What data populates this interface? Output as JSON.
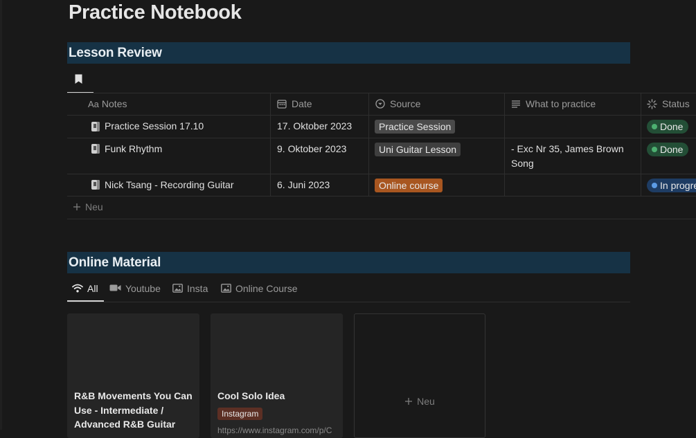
{
  "page": {
    "title": "Practice Notebook"
  },
  "lesson_review": {
    "header": "Lesson Review",
    "view_icon": "bookmark-icon",
    "columns": [
      {
        "label": "Notes",
        "icon": "text-aa-icon",
        "prefix": "Aa"
      },
      {
        "label": "Date",
        "icon": "calendar-icon"
      },
      {
        "label": "Source",
        "icon": "select-circle-icon"
      },
      {
        "label": "What to practice",
        "icon": "lines-icon"
      },
      {
        "label": "Status",
        "icon": "status-spinner-icon"
      }
    ],
    "rows": [
      {
        "notes": "Practice Session 17.10",
        "date": "17. Oktober 2023",
        "source": "Practice Session",
        "what_line1": "",
        "what_line2": "",
        "status": "Done"
      },
      {
        "notes": "Funk Rhythm",
        "date": "9. Oktober 2023",
        "source": "Uni Guitar Lesson",
        "what_line1": "- Exc Nr 35, James Brown",
        "what_line2": "Song",
        "status": "Done"
      },
      {
        "notes": "Nick Tsang - Recording Guitar",
        "date": "6. Juni 2023",
        "source": "Online course",
        "what_line1": "",
        "what_line2": "",
        "status": "In progress"
      }
    ],
    "new_label": "Neu"
  },
  "online_material": {
    "header": "Online Material",
    "tabs": [
      {
        "label": "All",
        "icon": "wifi-icon"
      },
      {
        "label": "Youtube",
        "icon": "video-camera-icon"
      },
      {
        "label": "Insta",
        "icon": "image-icon"
      },
      {
        "label": "Online Course",
        "icon": "image-icon"
      }
    ],
    "cards": [
      {
        "title_line1": "R&B Movements You Can",
        "title_line2": "Use - Intermediate /",
        "title_line3": "Advanced R&B Guitar",
        "tag": ""
      },
      {
        "title_line1": "Cool Solo Idea",
        "title_line2": "",
        "title_line3": "",
        "tag": "Instagram",
        "snippet": "https://www.instagram.com/p/C"
      }
    ],
    "new_label": "Neu"
  },
  "colors": {
    "background": "#191919",
    "section_header": "#163245",
    "tag_gray": "#4a4a4a",
    "tag_orange": "#a85620",
    "status_done": "#234e36",
    "status_in_progress": "#1e3c63",
    "tag_instagram": "#5c2f24"
  }
}
